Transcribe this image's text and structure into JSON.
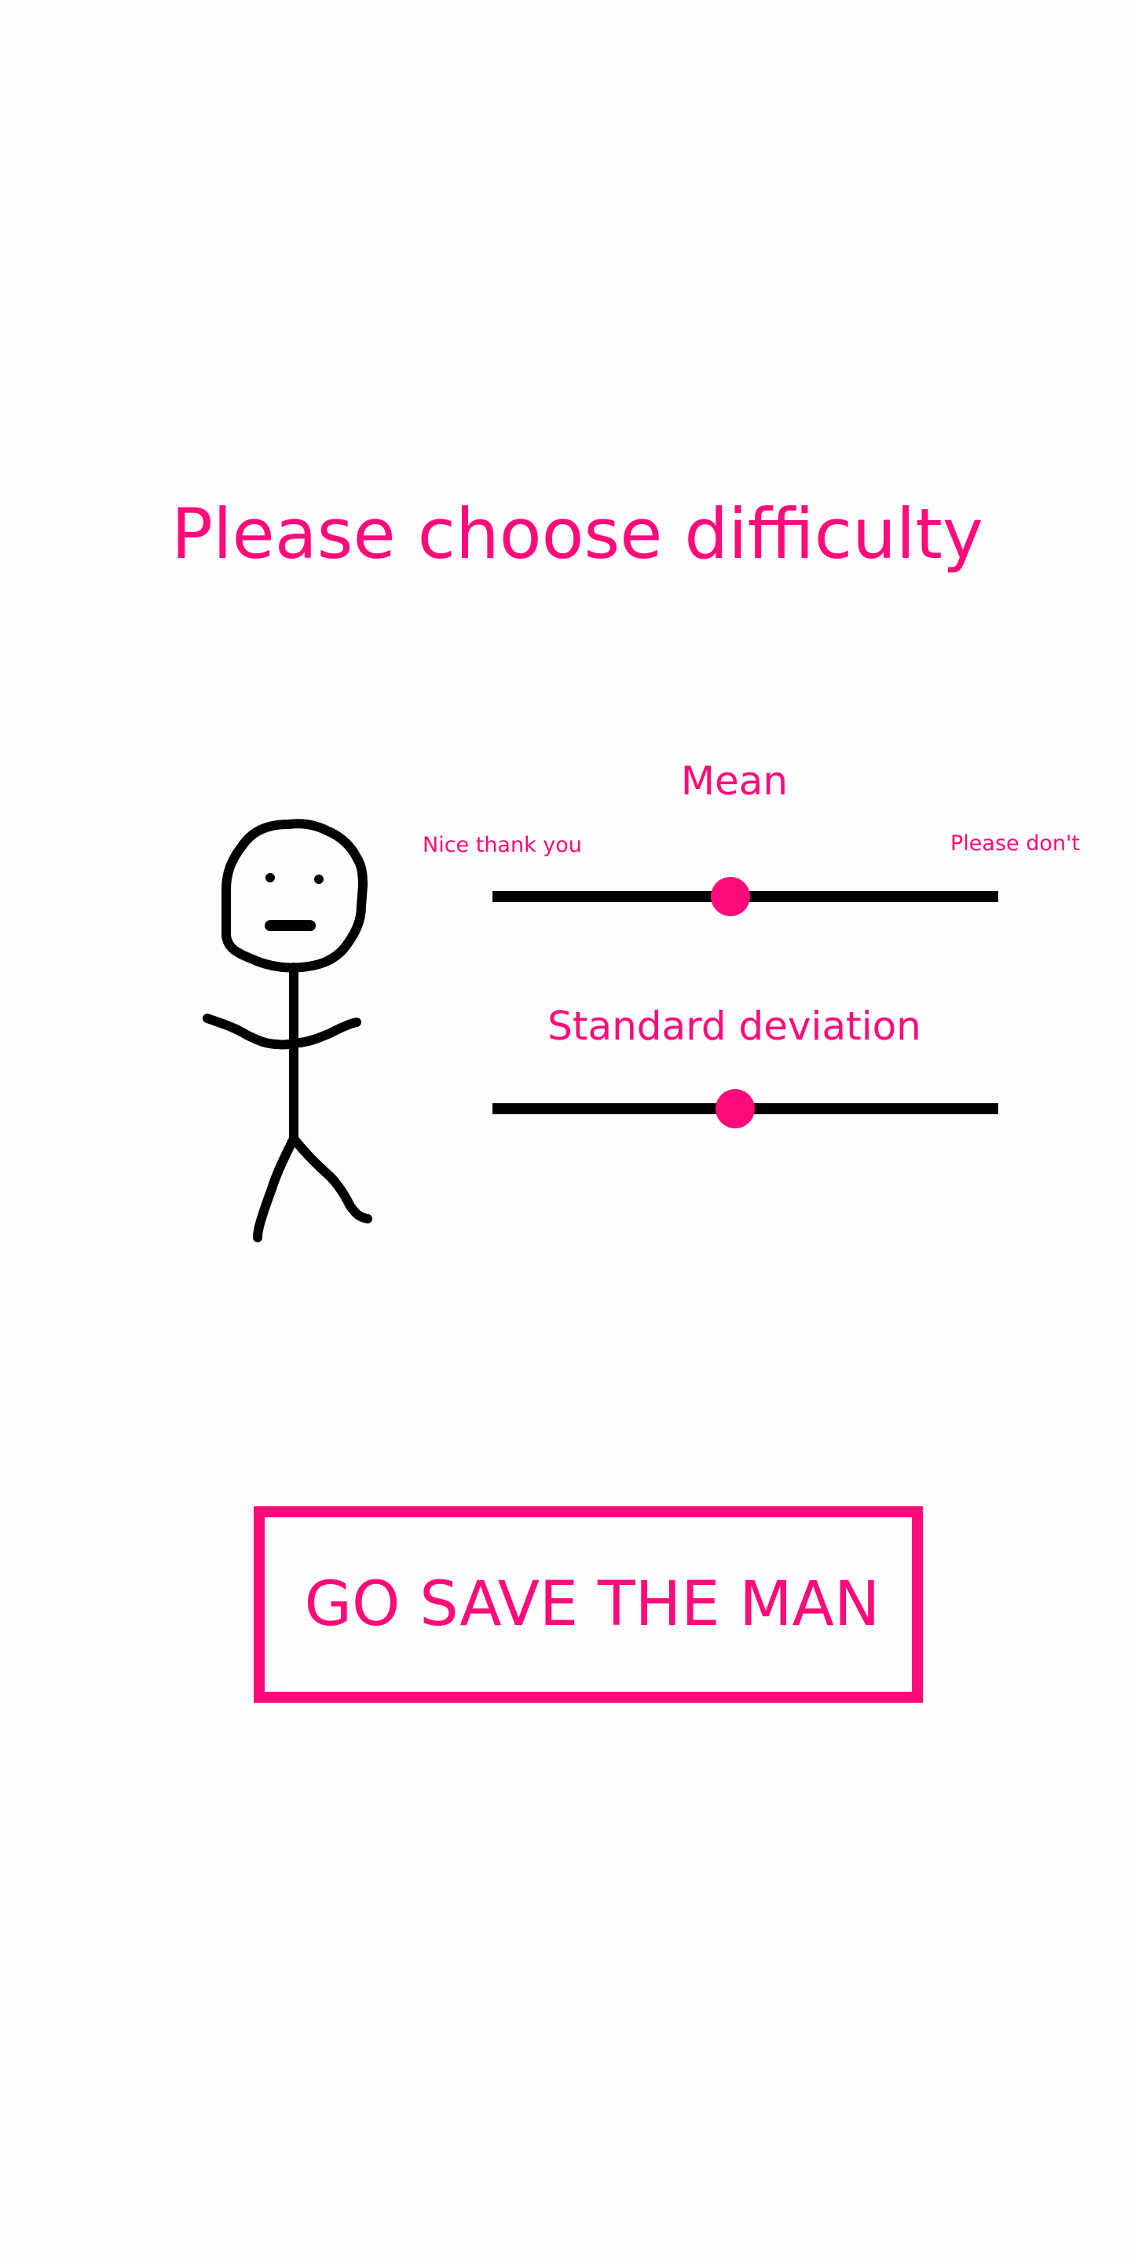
{
  "title": "Please choose difficulty",
  "sliders": {
    "mean": {
      "label": "Mean",
      "min_label": "Nice thank you",
      "max_label": "Please don't",
      "value": 0.47
    },
    "std_dev": {
      "label": "Standard deviation",
      "value": 0.48
    }
  },
  "start_button": {
    "label": "GO SAVE THE MAN"
  },
  "colors": {
    "accent": "#ff0a7a",
    "track": "#000000",
    "background": "#fdfdfd"
  },
  "icons": {
    "character": "stickman-icon"
  }
}
